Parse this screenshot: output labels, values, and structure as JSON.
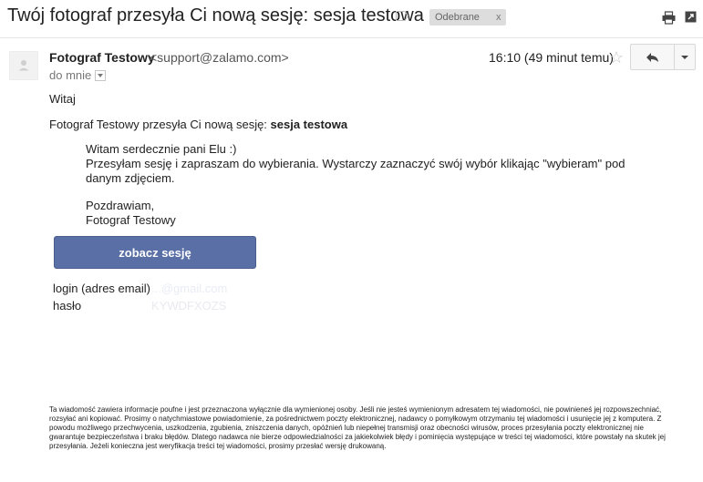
{
  "header": {
    "subject": "Twój fotograf przesyła Ci nową sesję: sesja testowa",
    "folder_chip": "Odebrane",
    "folder_chip_remove": "x"
  },
  "message": {
    "sender_name": "Fotograf Testowy",
    "sender_email": "<support@zalamo.com>",
    "recipient": "do mnie",
    "timestamp": "16:10 (49 minut temu)"
  },
  "body": {
    "greeting": "Witaj",
    "intro_prefix": "Fotograf Testowy przesyła Ci nową sesję: ",
    "intro_session": "sesja testowa",
    "line1": "Witam serdecznie pani Elu :)",
    "line2": "Przesyłam sesję i zapraszam do wybierania. Wystarczy zaznaczyć swój wybór klikając \"wybieram\" pod",
    "line3": "danym zdjęciem.",
    "closing": "Pozdrawiam,",
    "signature": "Fotograf Testowy",
    "cta_label": "zobacz sesję",
    "login_label": "login (adres email)",
    "login_value": "...@gmail.com",
    "password_label": "hasło",
    "password_value": "KYWDFXOZS"
  },
  "footer": {
    "disclaimer": "Ta wiadomość zawiera informacje poufne i jest przeznaczona wyłącznie dla wymienionej osoby. Jeśli nie jesteś wymienionym adresatem tej wiadomości, nie powinieneś jej rozpowszechniać, rozsyłać ani kopiować. Prosimy o natychmiastowe powiadomienie, za pośrednictwem poczty elektronicznej, nadawcy o pomyłkowym otrzymaniu tej wiadomości i usunięcie jej z komputera. Z powodu możliwego przechwycenia, uszkodzenia, zgubienia, zniszczenia danych, opóźnień lub niepełnej transmisji oraz obecności wirusów, proces przesyłania poczty elektronicznej nie gwarantuje bezpieczeństwa i braku błędów. Dlatego nadawca nie bierze odpowiedzialności za jakiekolwiek błędy i pominięcia występujące w treści tej wiadomości, które powstały na skutek jej przesyłania. Jeżeli konieczna jest weryfikacja treści tej wiadomości, prosimy przesłać wersję drukowaną."
  },
  "icons": {
    "label_tag": "label-tag-icon",
    "print": "print-icon",
    "new_window": "new-window-icon",
    "star": "star-icon",
    "reply": "reply-icon",
    "more": "chevron-down-icon"
  },
  "colors": {
    "cta_background": "#5a6fa6",
    "folder_chip_background": "#dddddd"
  }
}
